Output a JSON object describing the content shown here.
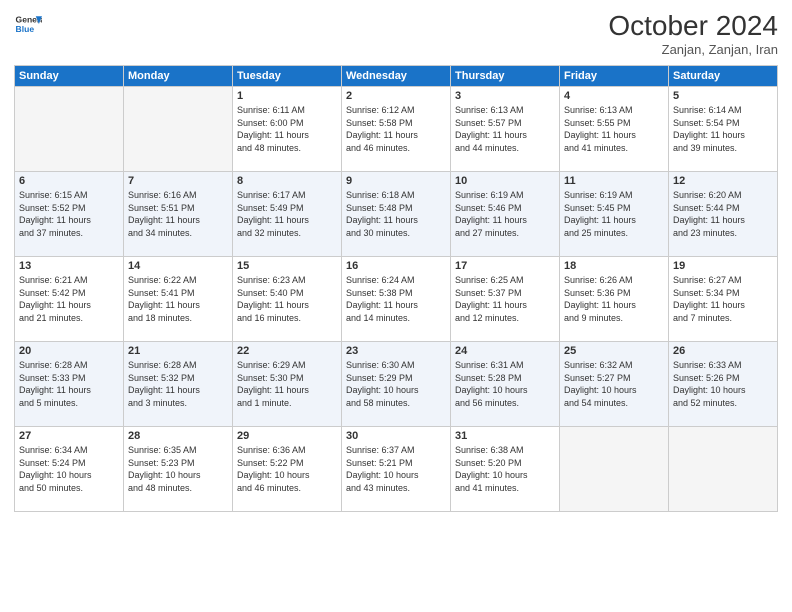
{
  "header": {
    "logo_line1": "General",
    "logo_line2": "Blue",
    "month_title": "October 2024",
    "subtitle": "Zanjan, Zanjan, Iran"
  },
  "weekdays": [
    "Sunday",
    "Monday",
    "Tuesday",
    "Wednesday",
    "Thursday",
    "Friday",
    "Saturday"
  ],
  "weeks": [
    [
      {
        "day": "",
        "info": ""
      },
      {
        "day": "",
        "info": ""
      },
      {
        "day": "1",
        "info": "Sunrise: 6:11 AM\nSunset: 6:00 PM\nDaylight: 11 hours\nand 48 minutes."
      },
      {
        "day": "2",
        "info": "Sunrise: 6:12 AM\nSunset: 5:58 PM\nDaylight: 11 hours\nand 46 minutes."
      },
      {
        "day": "3",
        "info": "Sunrise: 6:13 AM\nSunset: 5:57 PM\nDaylight: 11 hours\nand 44 minutes."
      },
      {
        "day": "4",
        "info": "Sunrise: 6:13 AM\nSunset: 5:55 PM\nDaylight: 11 hours\nand 41 minutes."
      },
      {
        "day": "5",
        "info": "Sunrise: 6:14 AM\nSunset: 5:54 PM\nDaylight: 11 hours\nand 39 minutes."
      }
    ],
    [
      {
        "day": "6",
        "info": "Sunrise: 6:15 AM\nSunset: 5:52 PM\nDaylight: 11 hours\nand 37 minutes."
      },
      {
        "day": "7",
        "info": "Sunrise: 6:16 AM\nSunset: 5:51 PM\nDaylight: 11 hours\nand 34 minutes."
      },
      {
        "day": "8",
        "info": "Sunrise: 6:17 AM\nSunset: 5:49 PM\nDaylight: 11 hours\nand 32 minutes."
      },
      {
        "day": "9",
        "info": "Sunrise: 6:18 AM\nSunset: 5:48 PM\nDaylight: 11 hours\nand 30 minutes."
      },
      {
        "day": "10",
        "info": "Sunrise: 6:19 AM\nSunset: 5:46 PM\nDaylight: 11 hours\nand 27 minutes."
      },
      {
        "day": "11",
        "info": "Sunrise: 6:19 AM\nSunset: 5:45 PM\nDaylight: 11 hours\nand 25 minutes."
      },
      {
        "day": "12",
        "info": "Sunrise: 6:20 AM\nSunset: 5:44 PM\nDaylight: 11 hours\nand 23 minutes."
      }
    ],
    [
      {
        "day": "13",
        "info": "Sunrise: 6:21 AM\nSunset: 5:42 PM\nDaylight: 11 hours\nand 21 minutes."
      },
      {
        "day": "14",
        "info": "Sunrise: 6:22 AM\nSunset: 5:41 PM\nDaylight: 11 hours\nand 18 minutes."
      },
      {
        "day": "15",
        "info": "Sunrise: 6:23 AM\nSunset: 5:40 PM\nDaylight: 11 hours\nand 16 minutes."
      },
      {
        "day": "16",
        "info": "Sunrise: 6:24 AM\nSunset: 5:38 PM\nDaylight: 11 hours\nand 14 minutes."
      },
      {
        "day": "17",
        "info": "Sunrise: 6:25 AM\nSunset: 5:37 PM\nDaylight: 11 hours\nand 12 minutes."
      },
      {
        "day": "18",
        "info": "Sunrise: 6:26 AM\nSunset: 5:36 PM\nDaylight: 11 hours\nand 9 minutes."
      },
      {
        "day": "19",
        "info": "Sunrise: 6:27 AM\nSunset: 5:34 PM\nDaylight: 11 hours\nand 7 minutes."
      }
    ],
    [
      {
        "day": "20",
        "info": "Sunrise: 6:28 AM\nSunset: 5:33 PM\nDaylight: 11 hours\nand 5 minutes."
      },
      {
        "day": "21",
        "info": "Sunrise: 6:28 AM\nSunset: 5:32 PM\nDaylight: 11 hours\nand 3 minutes."
      },
      {
        "day": "22",
        "info": "Sunrise: 6:29 AM\nSunset: 5:30 PM\nDaylight: 11 hours\nand 1 minute."
      },
      {
        "day": "23",
        "info": "Sunrise: 6:30 AM\nSunset: 5:29 PM\nDaylight: 10 hours\nand 58 minutes."
      },
      {
        "day": "24",
        "info": "Sunrise: 6:31 AM\nSunset: 5:28 PM\nDaylight: 10 hours\nand 56 minutes."
      },
      {
        "day": "25",
        "info": "Sunrise: 6:32 AM\nSunset: 5:27 PM\nDaylight: 10 hours\nand 54 minutes."
      },
      {
        "day": "26",
        "info": "Sunrise: 6:33 AM\nSunset: 5:26 PM\nDaylight: 10 hours\nand 52 minutes."
      }
    ],
    [
      {
        "day": "27",
        "info": "Sunrise: 6:34 AM\nSunset: 5:24 PM\nDaylight: 10 hours\nand 50 minutes."
      },
      {
        "day": "28",
        "info": "Sunrise: 6:35 AM\nSunset: 5:23 PM\nDaylight: 10 hours\nand 48 minutes."
      },
      {
        "day": "29",
        "info": "Sunrise: 6:36 AM\nSunset: 5:22 PM\nDaylight: 10 hours\nand 46 minutes."
      },
      {
        "day": "30",
        "info": "Sunrise: 6:37 AM\nSunset: 5:21 PM\nDaylight: 10 hours\nand 43 minutes."
      },
      {
        "day": "31",
        "info": "Sunrise: 6:38 AM\nSunset: 5:20 PM\nDaylight: 10 hours\nand 41 minutes."
      },
      {
        "day": "",
        "info": ""
      },
      {
        "day": "",
        "info": ""
      }
    ]
  ]
}
